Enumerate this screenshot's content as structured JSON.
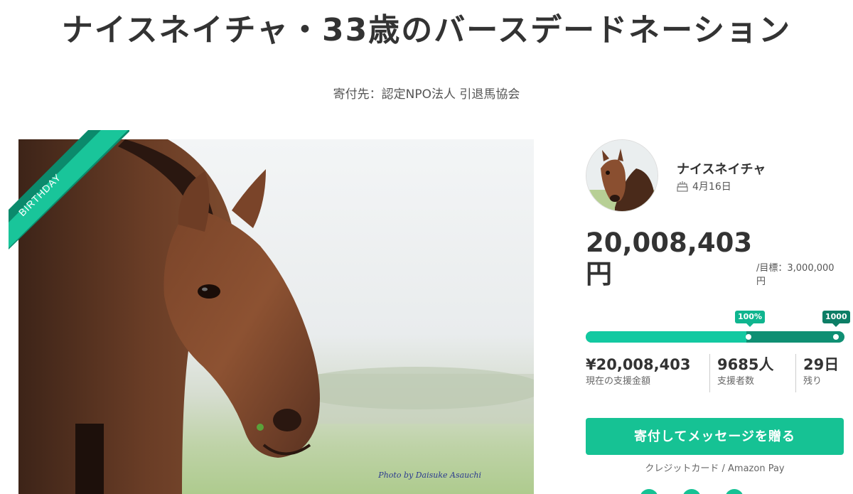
{
  "page": {
    "title": "ナイスネイチャ・33歳のバースデードネーション",
    "recipient": "寄付先：認定NPO法人 引退馬協会"
  },
  "hero": {
    "ribbon_label": "BIRTHDAY",
    "photo_credit": "Photo by Daisuke Asauchi"
  },
  "profile": {
    "name": "ナイスネイチャ",
    "birthday": "4月16日",
    "birthday_icon": "cake-icon"
  },
  "funding": {
    "amount_line1": "20,008,403",
    "amount_line2": "円",
    "goal_line1": "/目標：3,000,000",
    "goal_line2": "円",
    "progress_fraction": 0.62,
    "milestones": [
      {
        "label": "100%"
      },
      {
        "label": "1000"
      }
    ],
    "stats": [
      {
        "value": "¥20,008,403",
        "label": "現在の支援金額"
      },
      {
        "value": "9685人",
        "label": "支援者数"
      },
      {
        "value": "29日",
        "label": "残り"
      }
    ]
  },
  "actions": {
    "donate_label": "寄付してメッセージを贈る",
    "payment_methods": "クレジットカード / Amazon Pay"
  },
  "colors": {
    "accent": "#16c294",
    "accent_dark": "#0f8f73",
    "text": "#333333"
  }
}
